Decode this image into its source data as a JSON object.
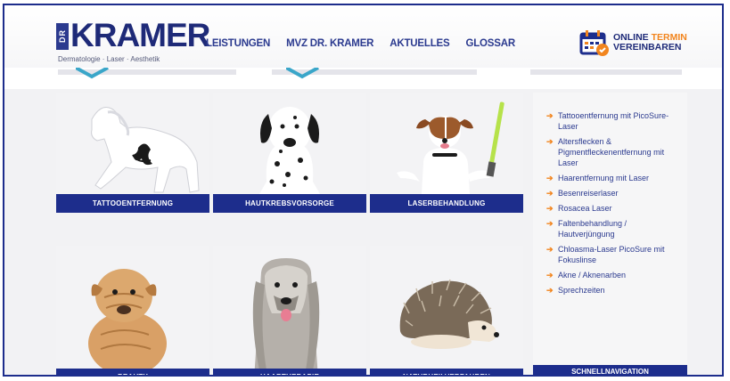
{
  "header": {
    "logo": {
      "prefix": "DR",
      "name": "KRAMER",
      "tagline": "Dermatologie · Laser · Aesthetik"
    },
    "nav": [
      "LEISTUNGEN",
      "MVZ DR. KRAMER",
      "AKTUELLES",
      "GLOSSAR"
    ],
    "cta": {
      "line1_a": "ONLINE ",
      "line1_b": "TERMIN",
      "line2": "VEREINBAREN"
    }
  },
  "tiles": [
    {
      "label": "TATTOOENTFERNUNG",
      "image": "white-horse-with-tattoo"
    },
    {
      "label": "HAUTKREBSVORSORGE",
      "image": "dalmatian-dog"
    },
    {
      "label": "LASERBEHANDLUNG",
      "image": "jack-russell-with-lightsaber"
    },
    {
      "label": "BEAUTY",
      "image": "shar-pei-puppy"
    },
    {
      "label": "HAARTHERAPIE",
      "image": "afghan-hound"
    },
    {
      "label": "NATURHEILVERFAHREN",
      "image": "hedgehog"
    }
  ],
  "side": {
    "items": [
      "Tattooentfernung mit PicoSure-Laser",
      "Altersflecken & Pigmentfleckenentfernung mit Laser",
      "Haarentfernung mit Laser",
      "Besenreiserlaser",
      "Rosacea Laser",
      "Faltenbehandlung / Hautverjüngung",
      "Chloasma-Laser PicoSure mit Fokuslinse",
      "Akne / Aknenarben",
      "Sprechzeiten"
    ],
    "footer": "SCHNELLNAVIGATION"
  },
  "colors": {
    "brand": "#1d2d8c",
    "accent": "#f2851e"
  }
}
